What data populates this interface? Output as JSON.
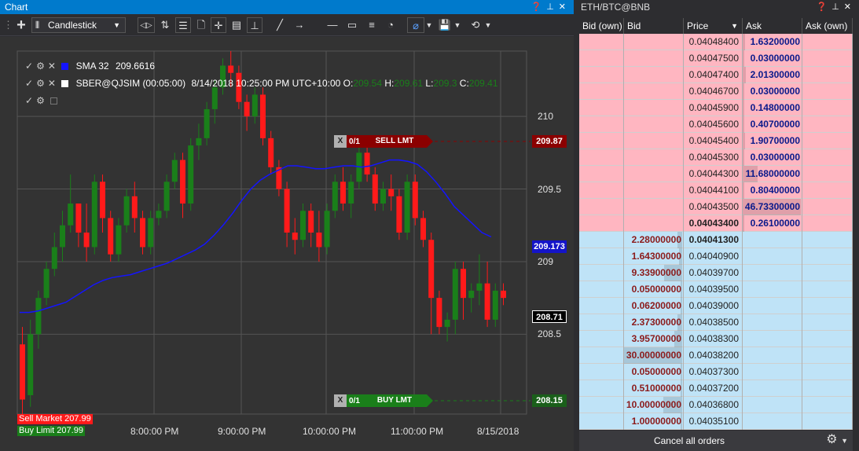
{
  "chart_window": {
    "title": "Chart",
    "chart_type_select": "Candlestick"
  },
  "legend": {
    "sma": {
      "label": "SMA 32",
      "value": "209.6616",
      "color": "#1414ff"
    },
    "instrument": {
      "label": "SBER@QJSIM (00:05:00)",
      "datetime": "8/14/2018 10:25:00 PM UTC+10:00",
      "o_label": "O:",
      "o": "209.54",
      "h_label": "H:",
      "h": "209.61",
      "l_label": "L:",
      "l": "209.3",
      "c_label": "C:",
      "c": "209.41"
    }
  },
  "orders": {
    "sell": {
      "x": "X",
      "qty": "0/1",
      "label": "SELL LMT",
      "price": "209.87"
    },
    "buy": {
      "x": "X",
      "qty": "0/1",
      "label": "BUY LMT",
      "price": "208.15"
    }
  },
  "price_tags": {
    "sma": "209.173",
    "last": "208.71"
  },
  "bottom_labels": {
    "sell_market": "Sell Market 207.99",
    "buy_limit": "Buy Limit 207.99"
  },
  "chart_data": {
    "type": "candlestick",
    "y_ticks": [
      "210",
      "209.5",
      "209",
      "208.5"
    ],
    "x_ticks": [
      "8:00:00 PM",
      "9:00:00 PM",
      "10:00:00 PM",
      "11:00:00 PM",
      "8/15/2018"
    ],
    "ylim": [
      207.95,
      210.45
    ],
    "colors": {
      "up": "#1a7f1a",
      "down": "#ff1a1a",
      "sma": "#1414ff"
    },
    "candles": [
      [
        208.43,
        208.55,
        207.95,
        208.05
      ],
      [
        208.08,
        208.6,
        208.0,
        208.5
      ],
      [
        208.5,
        208.8,
        208.4,
        208.75
      ],
      [
        208.75,
        209.0,
        208.7,
        208.95
      ],
      [
        208.95,
        209.2,
        208.9,
        209.1
      ],
      [
        209.1,
        209.35,
        209.0,
        209.25
      ],
      [
        209.25,
        209.6,
        209.2,
        209.4
      ],
      [
        209.4,
        209.4,
        209.1,
        209.2
      ],
      [
        209.2,
        209.4,
        209.0,
        209.1
      ],
      [
        209.1,
        209.6,
        209.05,
        209.55
      ],
      [
        209.55,
        209.6,
        209.2,
        209.3
      ],
      [
        209.3,
        209.35,
        209.0,
        209.05
      ],
      [
        209.05,
        209.3,
        209.0,
        209.25
      ],
      [
        209.25,
        209.5,
        209.2,
        209.45
      ],
      [
        209.45,
        209.55,
        209.2,
        209.3
      ],
      [
        209.3,
        209.35,
        209.05,
        209.1
      ],
      [
        209.1,
        209.35,
        209.05,
        209.3
      ],
      [
        209.3,
        209.4,
        209.25,
        209.35
      ],
      [
        209.35,
        209.6,
        209.3,
        209.55
      ],
      [
        209.55,
        209.75,
        209.5,
        209.7
      ],
      [
        209.7,
        209.75,
        209.3,
        209.4
      ],
      [
        209.4,
        209.85,
        209.35,
        209.8
      ],
      [
        209.8,
        209.95,
        209.7,
        209.85
      ],
      [
        209.85,
        210.1,
        209.8,
        210.05
      ],
      [
        210.05,
        210.25,
        209.95,
        210.2
      ],
      [
        210.2,
        210.4,
        210.15,
        210.35
      ],
      [
        210.35,
        210.45,
        210.2,
        210.3
      ],
      [
        210.3,
        210.35,
        210.05,
        210.1
      ],
      [
        210.1,
        210.15,
        209.9,
        210.0
      ],
      [
        210.0,
        210.2,
        209.95,
        210.15
      ],
      [
        210.15,
        210.2,
        209.8,
        209.85
      ],
      [
        209.85,
        209.9,
        209.6,
        209.65
      ],
      [
        209.65,
        209.7,
        209.45,
        209.5
      ],
      [
        209.5,
        209.55,
        209.1,
        209.2
      ],
      [
        209.2,
        209.3,
        209.05,
        209.15
      ],
      [
        209.15,
        209.4,
        209.1,
        209.35
      ],
      [
        209.35,
        209.4,
        209.1,
        209.2
      ],
      [
        209.2,
        209.35,
        209.0,
        209.1
      ],
      [
        209.1,
        209.4,
        209.05,
        209.35
      ],
      [
        209.35,
        209.6,
        209.3,
        209.55
      ],
      [
        209.55,
        209.65,
        209.35,
        209.4
      ],
      [
        209.4,
        209.6,
        209.3,
        209.55
      ],
      [
        209.55,
        209.8,
        209.5,
        209.75
      ],
      [
        209.75,
        209.8,
        209.55,
        209.6
      ],
      [
        209.6,
        209.65,
        209.35,
        209.4
      ],
      [
        209.4,
        209.55,
        209.35,
        209.5
      ],
      [
        209.5,
        209.6,
        209.35,
        209.45
      ],
      [
        209.45,
        209.5,
        209.15,
        209.2
      ],
      [
        209.2,
        209.6,
        209.15,
        209.55
      ],
      [
        209.55,
        209.6,
        209.25,
        209.3
      ],
      [
        209.3,
        209.35,
        209.1,
        209.15
      ],
      [
        209.15,
        209.2,
        208.5,
        208.75
      ],
      [
        208.75,
        208.8,
        208.5,
        208.55
      ],
      [
        208.55,
        208.65,
        208.45,
        208.6
      ],
      [
        208.6,
        209.0,
        208.5,
        208.95
      ],
      [
        208.95,
        209.0,
        208.6,
        208.75
      ],
      [
        208.75,
        208.85,
        208.65,
        208.8
      ],
      [
        208.8,
        209.05,
        208.7,
        208.85
      ],
      [
        208.85,
        209.0,
        208.55,
        208.6
      ],
      [
        208.6,
        208.85,
        208.55,
        208.8
      ],
      [
        208.8,
        208.85,
        208.7,
        208.75
      ]
    ],
    "sma_series": [
      208.65,
      208.65,
      208.66,
      208.68,
      208.7,
      208.72,
      208.76,
      208.8,
      208.84,
      208.87,
      208.89,
      208.9,
      208.91,
      208.93,
      208.95,
      208.97,
      208.99,
      209.02,
      209.05,
      209.08,
      209.12,
      209.18,
      209.25,
      209.33,
      209.42,
      209.5,
      209.56,
      209.6,
      209.63,
      209.66,
      209.66,
      209.65,
      209.64,
      209.64,
      209.65,
      209.66,
      209.66,
      209.65,
      209.66,
      209.68,
      209.7,
      209.7,
      209.69,
      209.67,
      209.62,
      209.55,
      209.47,
      209.38,
      209.32,
      209.26,
      209.2,
      209.17
    ]
  },
  "order_book": {
    "title": "ETH/BTC@BNB",
    "columns": [
      "Bid (own)",
      "Bid",
      "Price",
      "Ask",
      "Ask (own)"
    ],
    "asks": [
      {
        "price": "0.04048400",
        "ask": "1.63200000",
        "vol": 0.04
      },
      {
        "price": "0.04047500",
        "ask": "0.03000000",
        "vol": 0.01
      },
      {
        "price": "0.04047400",
        "ask": "2.01300000",
        "vol": 0.05
      },
      {
        "price": "0.04046700",
        "ask": "0.03000000",
        "vol": 0.01
      },
      {
        "price": "0.04045900",
        "ask": "0.14800000",
        "vol": 0.01
      },
      {
        "price": "0.04045600",
        "ask": "0.40700000",
        "vol": 0.01
      },
      {
        "price": "0.04045400",
        "ask": "1.90700000",
        "vol": 0.04
      },
      {
        "price": "0.04045300",
        "ask": "0.03000000",
        "vol": 0.01
      },
      {
        "price": "0.04044300",
        "ask": "11.68000000",
        "vol": 0.25
      },
      {
        "price": "0.04044100",
        "ask": "0.80400000",
        "vol": 0.02
      },
      {
        "price": "0.04043500",
        "ask": "46.73300000",
        "vol": 1.0
      },
      {
        "price": "0.04043400",
        "ask": "0.26100000",
        "vol": 0.01,
        "best": true
      }
    ],
    "bids": [
      {
        "price": "0.04041300",
        "bid": "2.28000000",
        "vol": 0.08,
        "best": true
      },
      {
        "price": "0.04040900",
        "bid": "1.64300000",
        "vol": 0.05
      },
      {
        "price": "0.04039700",
        "bid": "9.33900000",
        "vol": 0.31
      },
      {
        "price": "0.04039500",
        "bid": "0.05000000",
        "vol": 0.01
      },
      {
        "price": "0.04039000",
        "bid": "0.06200000",
        "vol": 0.01
      },
      {
        "price": "0.04038500",
        "bid": "2.37300000",
        "vol": 0.08
      },
      {
        "price": "0.04038300",
        "bid": "3.95700000",
        "vol": 0.13
      },
      {
        "price": "0.04038200",
        "bid": "30.00000000",
        "vol": 1.0
      },
      {
        "price": "0.04037300",
        "bid": "0.05000000",
        "vol": 0.01
      },
      {
        "price": "0.04037200",
        "bid": "0.51000000",
        "vol": 0.02
      },
      {
        "price": "0.04036800",
        "bid": "10.00000000",
        "vol": 0.33
      },
      {
        "price": "0.04035100",
        "bid": "1.00000000",
        "vol": 0.03
      }
    ],
    "cancel_label": "Cancel all orders"
  }
}
